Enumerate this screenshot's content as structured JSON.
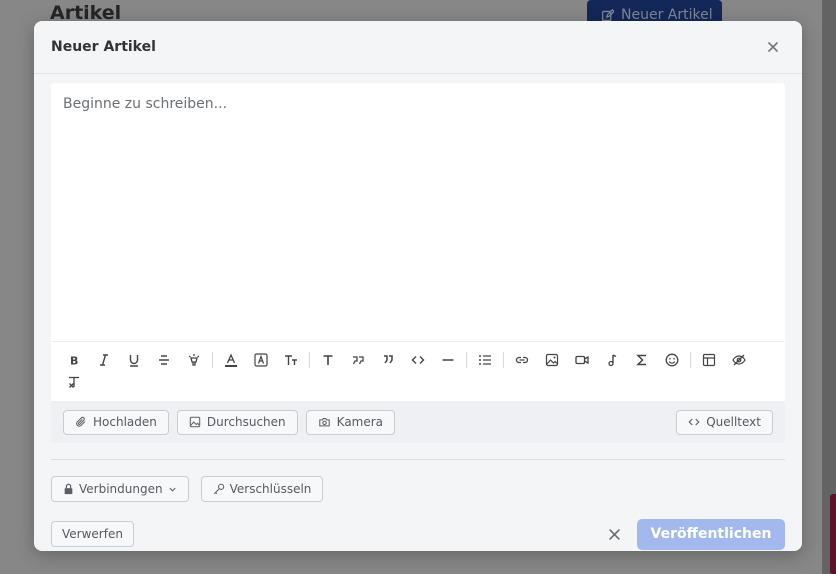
{
  "background": {
    "page_title": "Artikel",
    "new_button_label": "Neuer Artikel"
  },
  "modal": {
    "title": "Neuer Artikel",
    "editor_placeholder": "Beginne zu schreiben...",
    "toolbar_icons": [
      "bold-icon",
      "italic-icon",
      "underline-icon",
      "strikethrough-icon",
      "highlight-icon",
      "text-color-icon",
      "background-color-icon",
      "font-size-icon",
      "heading-icon",
      "blockquote-icon",
      "quote-icon",
      "code-icon",
      "horizontal-rule-icon",
      "bullet-list-icon",
      "link-icon",
      "image-icon",
      "video-icon",
      "audio-icon",
      "formula-icon",
      "emoji-icon",
      "table-icon",
      "spoiler-icon",
      "clear-format-icon"
    ],
    "attachments": {
      "upload_label": "Hochladen",
      "browse_label": "Durchsuchen",
      "camera_label": "Kamera",
      "source_label": "Quelltext"
    },
    "options": {
      "connections_label": "Verbindungen",
      "encrypt_label": "Verschlüsseln"
    },
    "footer": {
      "discard_label": "Verwerfen",
      "publish_label": "Veröffentlichen"
    }
  },
  "colors": {
    "primary": "#1e3f8c",
    "publish_disabled": "#a3b9ee"
  }
}
